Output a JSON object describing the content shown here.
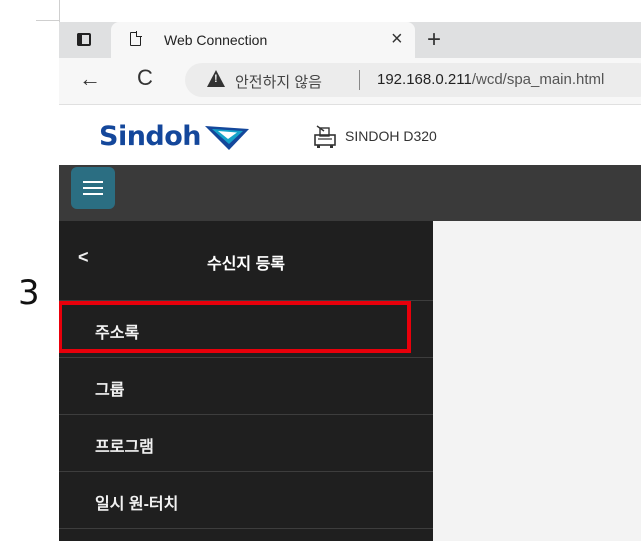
{
  "step_number": "3",
  "browser": {
    "tab_title": "Web Connection",
    "tab_close": "×",
    "new_tab": "+",
    "back": "←",
    "reload": "C",
    "security_text": "안전하지 않음",
    "url_host": "192.168.0.211",
    "url_path": "/wcd/spa_main.html"
  },
  "header": {
    "logo_text": "Sindoh",
    "device_name": "SINDOH D320"
  },
  "sidebar": {
    "back_label": "<",
    "title": "수신지 등록",
    "items": [
      {
        "label": "주소록"
      },
      {
        "label": "그룹"
      },
      {
        "label": "프로그램"
      },
      {
        "label": "일시 원-터치"
      }
    ]
  },
  "colors": {
    "brand_blue": "#14479b",
    "brand_cyan": "#16a3c9",
    "menu_button": "#2b6e82",
    "highlight": "#e8000b",
    "sidebar_bg": "#1f1f1f"
  },
  "icons": {
    "tab_actions": "tab-actions-icon",
    "page": "page-icon",
    "warning": "warning-icon",
    "printer": "printer-icon",
    "menu": "hamburger-icon"
  }
}
